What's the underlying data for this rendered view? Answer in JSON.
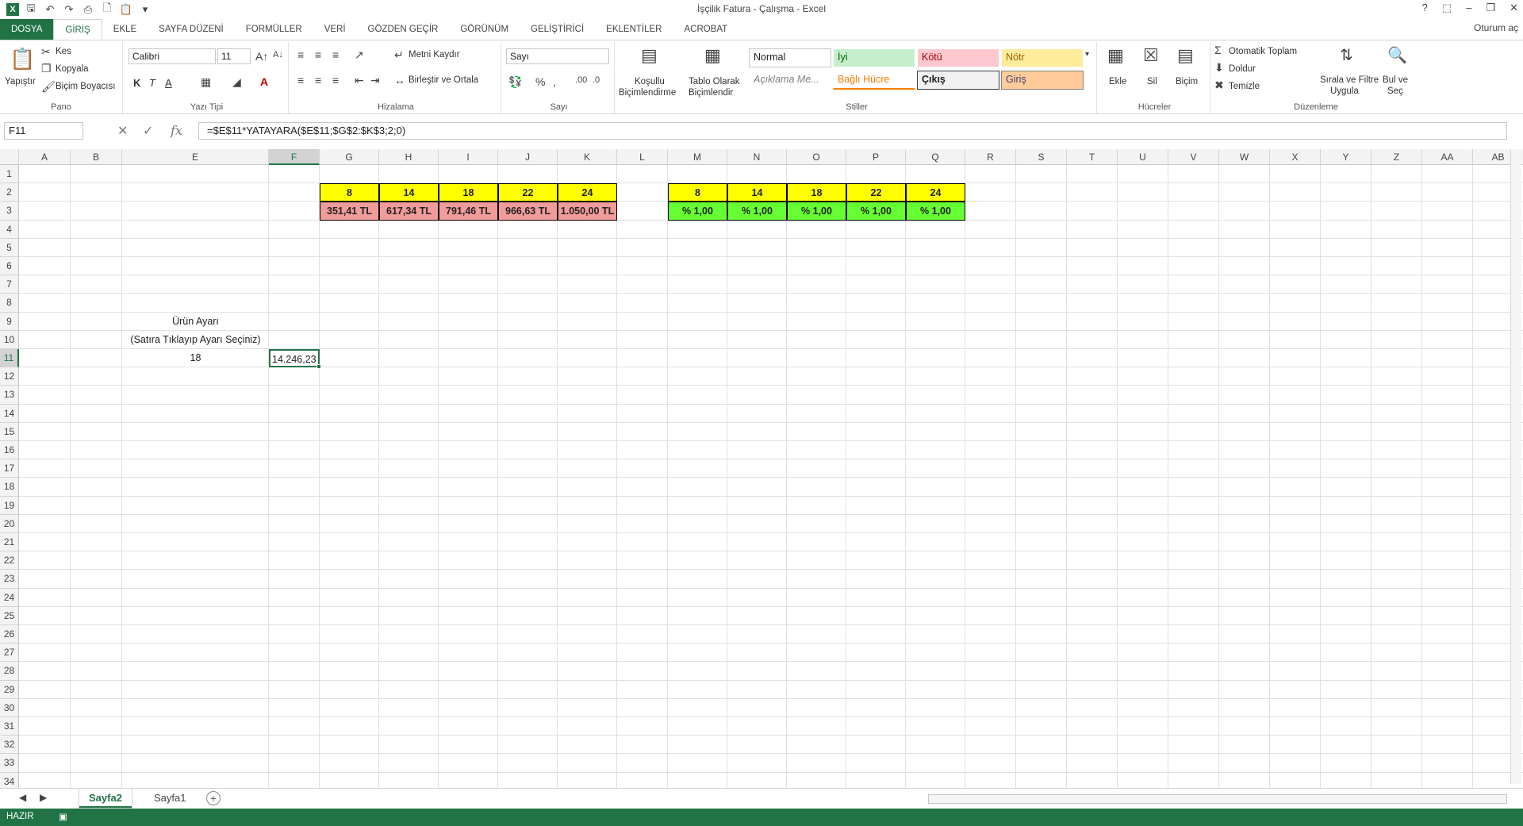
{
  "window": {
    "title": "İşçilik Fatura - Çalışma - Excel",
    "signin": "Oturum aç"
  },
  "tabs": [
    "DOSYA",
    "GİRİŞ",
    "EKLE",
    "SAYFA DÜZENİ",
    "FORMÜLLER",
    "VERİ",
    "GÖZDEN GEÇİR",
    "GÖRÜNÜM",
    "GELİŞTİRİCİ",
    "EKLENTİLER",
    "ACROBAT"
  ],
  "ribbon": {
    "pano": {
      "label": "Pano",
      "paste": "Yapıştır",
      "cut": "Kes",
      "copy": "Kopyala",
      "format_painter": "Biçim Boyacısı"
    },
    "font": {
      "label": "Yazı Tipi",
      "name": "Calibri",
      "size": "11",
      "bold": "K",
      "italic": "T",
      "underline": "A"
    },
    "align": {
      "label": "Hizalama",
      "wrap": "Metni Kaydır",
      "merge": "Birleştir ve Ortala"
    },
    "number": {
      "label": "Sayı",
      "format": "Sayı"
    },
    "styles": {
      "label": "Stiller",
      "conditional": [
        "Koşullu",
        "Biçimlendirme"
      ],
      "table": [
        "Tablo Olarak",
        "Biçimlendir"
      ],
      "normal": "Normal",
      "good": "İyi",
      "bad": "Kötü",
      "neutral": "Nötr",
      "note": "Açıklama Me...",
      "linked": "Bağlı Hücre",
      "output": "Çıkış",
      "input": "Giriş"
    },
    "cells": {
      "label": "Hücreler",
      "insert": "Ekle",
      "delete": "Sil",
      "format": "Biçim"
    },
    "editing": {
      "label": "Düzenleme",
      "autosum": "Otomatik Toplam",
      "fill": "Doldur",
      "clear": "Temizle",
      "sort": [
        "Sırala ve Filtre",
        "Uygula"
      ],
      "find": [
        "Bul ve",
        "Seç"
      ]
    }
  },
  "formula_bar": {
    "name_box": "F11",
    "fx": "fx",
    "formula": "=$E$11*YATAYARA($E$11;$G$2:$K$3;2;0)"
  },
  "columns": [
    "A",
    "B",
    "E",
    "F",
    "G",
    "H",
    "I",
    "J",
    "K",
    "L",
    "M",
    "N",
    "O",
    "P",
    "Q",
    "R",
    "S",
    "T",
    "U",
    "V",
    "W",
    "X",
    "Y",
    "Z",
    "AA",
    "AB"
  ],
  "rows": [
    "1",
    "2",
    "3",
    "4",
    "5",
    "6",
    "7",
    "8",
    "9",
    "10",
    "11",
    "12",
    "13",
    "14",
    "15",
    "16",
    "17",
    "18",
    "19",
    "20",
    "21",
    "22",
    "23",
    "24",
    "25",
    "26",
    "27",
    "28",
    "29",
    "30",
    "31",
    "32",
    "33",
    "34"
  ],
  "sheet": {
    "table1_headers": [
      "8",
      "14",
      "18",
      "22",
      "24"
    ],
    "table1_values": [
      "351,41 TL",
      "617,34 TL",
      "791,46 TL",
      "966,63 TL",
      "1.050,00 TL"
    ],
    "table2_headers": [
      "8",
      "14",
      "18",
      "22",
      "24"
    ],
    "table2_values": [
      "% 1,00",
      "% 1,00",
      "% 1,00",
      "% 1,00",
      "% 1,00"
    ],
    "e9": "Ürün Ayarı",
    "e10": "(Satıra Tıklayıp Ayarı Seçiniz)",
    "e11": "18",
    "f11": "14.246,23"
  },
  "sheet_tabs": [
    "Sayfa2",
    "Sayfa1"
  ],
  "status": {
    "ready": "HAZIR"
  }
}
